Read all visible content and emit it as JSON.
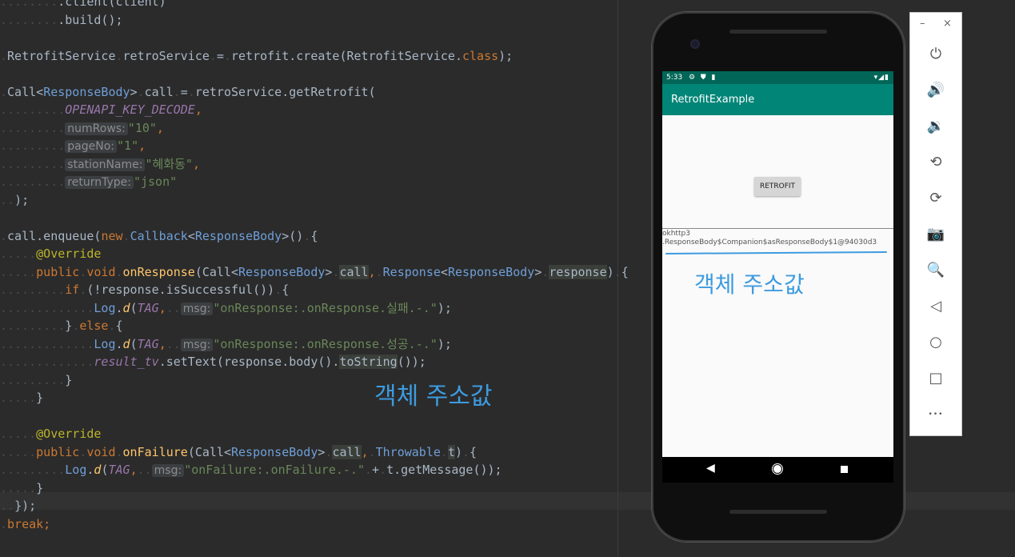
{
  "editor": {
    "lines": [
      [
        {
          "c": "dot",
          "t": "........"
        },
        {
          "c": "cls",
          "t": ".client(client)"
        }
      ],
      [
        {
          "c": "dot",
          "t": "........"
        },
        {
          "c": "cls",
          "t": ".build();"
        }
      ],
      [],
      [
        {
          "c": "dot",
          "t": "."
        },
        {
          "c": "typ2",
          "t": "RetrofitService"
        },
        {
          "c": "dot",
          "t": "."
        },
        {
          "c": "cls",
          "t": "retroService"
        },
        {
          "c": "dot",
          "t": "."
        },
        {
          "c": "cls",
          "t": "="
        },
        {
          "c": "dot",
          "t": "."
        },
        {
          "c": "cls",
          "t": "retrofit.create("
        },
        {
          "c": "typ2",
          "t": "RetrofitService"
        },
        {
          "c": "cls",
          "t": "."
        },
        {
          "c": "kw",
          "t": "class"
        },
        {
          "c": "cls",
          "t": ");"
        }
      ],
      [],
      [
        {
          "c": "dot",
          "t": "."
        },
        {
          "c": "typ2",
          "t": "Call<"
        },
        {
          "c": "generic",
          "t": "ResponseBody"
        },
        {
          "c": "typ2",
          "t": ">"
        },
        {
          "c": "dot",
          "t": "."
        },
        {
          "c": "cls",
          "t": "call"
        },
        {
          "c": "dot",
          "t": "."
        },
        {
          "c": "cls",
          "t": "="
        },
        {
          "c": "dot",
          "t": "."
        },
        {
          "c": "cls",
          "t": "retroService.getRetrofit("
        }
      ],
      [
        {
          "c": "dot",
          "t": "........."
        },
        {
          "c": "const",
          "t": "OPENAPI_KEY_DECODE"
        },
        {
          "c": "kw",
          "t": ","
        }
      ],
      [
        {
          "c": "dot",
          "t": "........."
        },
        {
          "c": "hint",
          "t": "numRows:"
        },
        {
          "c": "str",
          "t": "\"10\""
        },
        {
          "c": "kw",
          "t": ","
        }
      ],
      [
        {
          "c": "dot",
          "t": "........."
        },
        {
          "c": "hint",
          "t": "pageNo:"
        },
        {
          "c": "str",
          "t": "\"1\""
        },
        {
          "c": "kw",
          "t": ","
        }
      ],
      [
        {
          "c": "dot",
          "t": "........."
        },
        {
          "c": "hint",
          "t": "stationName:"
        },
        {
          "c": "str",
          "t": "\"혜화동\""
        },
        {
          "c": "kw",
          "t": ","
        }
      ],
      [
        {
          "c": "dot",
          "t": "........."
        },
        {
          "c": "hint",
          "t": "returnType:"
        },
        {
          "c": "str",
          "t": "\"json\""
        }
      ],
      [
        {
          "c": "dot",
          "t": ".."
        },
        {
          "c": "cls",
          "t": ");"
        }
      ],
      [],
      [
        {
          "c": "dot",
          "t": "."
        },
        {
          "c": "cls",
          "t": "call.enqueue("
        },
        {
          "c": "kw",
          "t": "new"
        },
        {
          "c": "dot",
          "t": "."
        },
        {
          "c": "generic",
          "t": "Callback"
        },
        {
          "c": "cls",
          "t": "<"
        },
        {
          "c": "generic",
          "t": "ResponseBody"
        },
        {
          "c": "cls",
          "t": ">()"
        },
        {
          "c": "dot",
          "t": "."
        },
        {
          "c": "cls",
          "t": "{"
        }
      ],
      [
        {
          "c": "dot",
          "t": "....."
        },
        {
          "c": "ann",
          "t": "@Override"
        }
      ],
      [
        {
          "c": "dot",
          "t": "....."
        },
        {
          "c": "kw",
          "t": "public"
        },
        {
          "c": "dot",
          "t": "."
        },
        {
          "c": "kw",
          "t": "void"
        },
        {
          "c": "dot",
          "t": "."
        },
        {
          "c": "meth",
          "t": "onResponse"
        },
        {
          "c": "cls",
          "t": "(Call<"
        },
        {
          "c": "generic",
          "t": "ResponseBody"
        },
        {
          "c": "cls",
          "t": ">"
        },
        {
          "c": "dot",
          "t": "."
        },
        {
          "c": "hl",
          "t": "call"
        },
        {
          "c": "kw",
          "t": ","
        },
        {
          "c": "dot",
          "t": "."
        },
        {
          "c": "generic",
          "t": "Response"
        },
        {
          "c": "cls",
          "t": "<"
        },
        {
          "c": "generic",
          "t": "ResponseBody"
        },
        {
          "c": "cls",
          "t": ">"
        },
        {
          "c": "dot",
          "t": "."
        },
        {
          "c": "hl",
          "t": "response"
        },
        {
          "c": "cls",
          "t": ")"
        },
        {
          "c": "dot",
          "t": "."
        },
        {
          "c": "cls",
          "t": "{"
        }
      ],
      [
        {
          "c": "dot",
          "t": "........."
        },
        {
          "c": "kw",
          "t": "if"
        },
        {
          "c": "dot",
          "t": "."
        },
        {
          "c": "cls",
          "t": "(!response.isSuccessful())"
        },
        {
          "c": "dot",
          "t": "."
        },
        {
          "c": "cls",
          "t": "{"
        }
      ],
      [
        {
          "c": "dot",
          "t": "............."
        },
        {
          "c": "logc",
          "t": "Log"
        },
        {
          "c": "cls",
          "t": "."
        },
        {
          "c": "meth ital",
          "t": "d"
        },
        {
          "c": "cls",
          "t": "("
        },
        {
          "c": "tag",
          "t": "TAG"
        },
        {
          "c": "kw",
          "t": ","
        },
        {
          "c": "dot",
          "t": ".."
        },
        {
          "c": "hint",
          "t": "msg:"
        },
        {
          "c": "str",
          "t": "\"onResponse:.onResponse.실패.-.\""
        },
        {
          "c": "cls",
          "t": ");"
        }
      ],
      [
        {
          "c": "dot",
          "t": "........."
        },
        {
          "c": "cls",
          "t": "}"
        },
        {
          "c": "dot",
          "t": "."
        },
        {
          "c": "kw",
          "t": "else"
        },
        {
          "c": "dot",
          "t": "."
        },
        {
          "c": "cls",
          "t": "{"
        }
      ],
      [
        {
          "c": "dot",
          "t": "............."
        },
        {
          "c": "logc",
          "t": "Log"
        },
        {
          "c": "cls",
          "t": "."
        },
        {
          "c": "meth ital",
          "t": "d"
        },
        {
          "c": "cls",
          "t": "("
        },
        {
          "c": "tag",
          "t": "TAG"
        },
        {
          "c": "kw",
          "t": ","
        },
        {
          "c": "dot",
          "t": ".."
        },
        {
          "c": "hint",
          "t": "msg:"
        },
        {
          "c": "str",
          "t": "\"onResponse:.onResponse.성공.-.\""
        },
        {
          "c": "cls",
          "t": ");"
        }
      ],
      [
        {
          "c": "dot",
          "t": "............."
        },
        {
          "c": "const",
          "t": "result_tv"
        },
        {
          "c": "cls",
          "t": ".setText(response.body()."
        },
        {
          "c": "hl",
          "t": "toString"
        },
        {
          "c": "cls",
          "t": "());"
        }
      ],
      [
        {
          "c": "dot",
          "t": "........."
        },
        {
          "c": "cls",
          "t": "}"
        }
      ],
      [
        {
          "c": "dot",
          "t": "....."
        },
        {
          "c": "cls",
          "t": "}"
        }
      ],
      [],
      [
        {
          "c": "dot",
          "t": "....."
        },
        {
          "c": "ann",
          "t": "@Override"
        }
      ],
      [
        {
          "c": "dot",
          "t": "....."
        },
        {
          "c": "kw",
          "t": "public"
        },
        {
          "c": "dot",
          "t": "."
        },
        {
          "c": "kw",
          "t": "void"
        },
        {
          "c": "dot",
          "t": "."
        },
        {
          "c": "meth",
          "t": "onFailure"
        },
        {
          "c": "cls",
          "t": "(Call<"
        },
        {
          "c": "generic",
          "t": "ResponseBody"
        },
        {
          "c": "cls",
          "t": ">"
        },
        {
          "c": "dot",
          "t": "."
        },
        {
          "c": "hl",
          "t": "call"
        },
        {
          "c": "kw",
          "t": ","
        },
        {
          "c": "dot",
          "t": "."
        },
        {
          "c": "generic",
          "t": "Throwable"
        },
        {
          "c": "dot",
          "t": "."
        },
        {
          "c": "hl",
          "t": "t"
        },
        {
          "c": "cls",
          "t": ")"
        },
        {
          "c": "dot",
          "t": "."
        },
        {
          "c": "cls",
          "t": "{"
        }
      ],
      [
        {
          "c": "dot",
          "t": "........."
        },
        {
          "c": "logc",
          "t": "Log"
        },
        {
          "c": "cls",
          "t": "."
        },
        {
          "c": "meth ital",
          "t": "d"
        },
        {
          "c": "cls",
          "t": "("
        },
        {
          "c": "tag",
          "t": "TAG"
        },
        {
          "c": "kw",
          "t": ","
        },
        {
          "c": "dot",
          "t": ".."
        },
        {
          "c": "hint",
          "t": "msg:"
        },
        {
          "c": "str",
          "t": "\"onFailure:.onFailure.-.\""
        },
        {
          "c": "dot",
          "t": "."
        },
        {
          "c": "cls",
          "t": "+"
        },
        {
          "c": "dot",
          "t": "."
        },
        {
          "c": "cls",
          "t": "t.getMessage());"
        }
      ],
      [
        {
          "c": "dot",
          "t": "....."
        },
        {
          "c": "cls",
          "t": "}"
        }
      ],
      [
        {
          "c": "dot",
          "t": ".."
        },
        {
          "c": "cls",
          "t": "});"
        }
      ],
      [
        {
          "c": "dot",
          "t": "."
        },
        {
          "c": "kw",
          "t": "break;"
        }
      ]
    ],
    "annotation": "객체 주소값"
  },
  "phone": {
    "status": {
      "time": "5:33",
      "left_icons": "⚙ ⛊ ▮",
      "right_icons": "▾◢▮"
    },
    "app_title": "RetrofitExample",
    "button_label": "RETROFIT",
    "result_line1": "okhttp3",
    "result_line2": ".ResponseBody$Companion$asResponseBody$1@94030d3",
    "annotation": "객체 주소값"
  },
  "side_panel": {
    "minimize": "–",
    "close": "×",
    "buttons": [
      {
        "name": "power-icon",
        "glyph": "⏻"
      },
      {
        "name": "volume-up-icon",
        "glyph": "🔊"
      },
      {
        "name": "volume-down-icon",
        "glyph": "🔉"
      },
      {
        "name": "rotate-left-icon",
        "glyph": "⟲"
      },
      {
        "name": "rotate-right-icon",
        "glyph": "⟳"
      },
      {
        "name": "camera-icon",
        "glyph": "📷"
      },
      {
        "name": "zoom-icon",
        "glyph": "🔍"
      },
      {
        "name": "back-icon",
        "glyph": "◁"
      },
      {
        "name": "home-icon",
        "glyph": "○"
      },
      {
        "name": "overview-icon",
        "glyph": "□"
      },
      {
        "name": "more-icon",
        "glyph": "•••"
      }
    ]
  }
}
